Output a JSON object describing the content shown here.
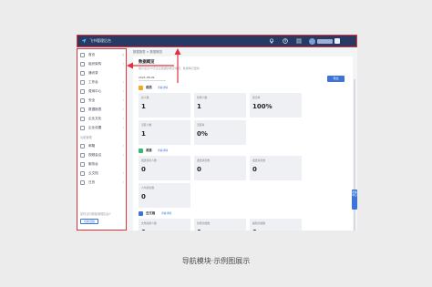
{
  "app": {
    "title": "飞书管理后台"
  },
  "topbar": {
    "icons": [
      "location-icon",
      "help-icon",
      "apps-grid-icon",
      "avatar",
      "user-icon"
    ],
    "colors": {
      "bar": "#273a63",
      "highlight": "#e0323a"
    }
  },
  "sidebar": {
    "items": [
      {
        "label": "首页",
        "icon": "home-icon",
        "chevron": "◁"
      },
      {
        "label": "组织架构",
        "icon": "org-icon",
        "chevron": "›"
      },
      {
        "label": "通讯录",
        "icon": "contacts-icon",
        "chevron": ""
      },
      {
        "label": "工作台",
        "icon": "workbench-icon",
        "chevron": "›"
      },
      {
        "label": "费用中心",
        "icon": "billing-icon",
        "chevron": "›"
      },
      {
        "label": "安全",
        "icon": "shield-icon",
        "chevron": "›"
      },
      {
        "label": "数据报表",
        "icon": "report-icon",
        "chevron": "›"
      },
      {
        "label": "企业文化",
        "icon": "culture-icon",
        "chevron": "›"
      },
      {
        "label": "企业设置",
        "icon": "settings-icon",
        "chevron": "›"
      }
    ],
    "section_label": "功能管理",
    "sub_items": [
      {
        "label": "邮箱",
        "icon": "mail-icon",
        "chevron": "›"
      },
      {
        "label": "视频会议",
        "icon": "video-icon",
        "chevron": "›"
      },
      {
        "label": "服务台",
        "icon": "helpdesk-icon",
        "chevron": ""
      },
      {
        "label": "云文档",
        "icon": "docs-icon",
        "chevron": "›"
      },
      {
        "label": "日历",
        "icon": "calendar-icon",
        "chevron": "›"
      }
    ],
    "help_text": "如何访问新版管理后台?",
    "switch_button": "切换旧版"
  },
  "content": {
    "breadcrumb": "数据报表 > 数据概览",
    "title": "数据概览",
    "subtitle": "展示最近30天企业数据的概览情况，数据每日更新",
    "date_range": "2021-08-09",
    "export_button": "导出",
    "sections": [
      {
        "title": "成员",
        "link": "查看详情",
        "icon_color": "#f5a623",
        "cards": [
          {
            "label": "总人数",
            "value": "1"
          },
          {
            "label": "新增人数",
            "value": "1"
          },
          {
            "label": "激活率",
            "value": "100%"
          },
          {
            "label": "活跃人数",
            "value": "1"
          },
          {
            "label": "活跃率",
            "value": "0%"
          }
        ]
      },
      {
        "title": "消息",
        "link": "查看详情",
        "icon_color": "#39b86e",
        "cards": [
          {
            "label": "发送消息人数",
            "value": "0"
          },
          {
            "label": "发送消息数",
            "value": "0"
          },
          {
            "label": "发送消息数",
            "value": "0"
          },
          {
            "label": "人均消息数",
            "value": "0"
          }
        ]
      },
      {
        "title": "云文档",
        "link": "查看详情",
        "icon_color": "#3e74d8",
        "cards": [
          {
            "label": "文档使用人数",
            "value": "0"
          },
          {
            "label": "新增文档数",
            "value": "0"
          },
          {
            "label": "编辑文档数",
            "value": "0"
          }
        ]
      }
    ],
    "float_button": "帮助中心"
  },
  "caption": "导航模块·示例图展示",
  "annotation_color": "#e0323a"
}
